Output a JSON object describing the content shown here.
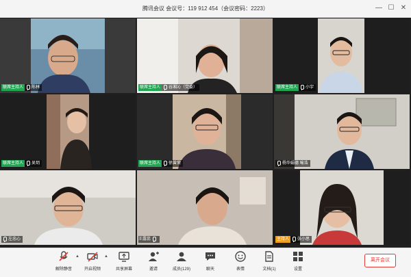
{
  "window": {
    "title": "腾讯会议 会议号：119 912 454（会议密码：2223）",
    "controls": [
      "—",
      "☐",
      "✕"
    ]
  },
  "participants": [
    {
      "role": "联席主持人",
      "name": "陈林",
      "role_color": "#21a653"
    },
    {
      "role": "联席主持人",
      "name": "谷湘沁（党委）",
      "role_color": "#21a653"
    },
    {
      "role": "联席主持人",
      "name": "小宇",
      "role_color": "#21a653"
    },
    {
      "role": "联席主持人",
      "name": "吴玥",
      "role_color": "#21a653"
    },
    {
      "role": "联席主持人",
      "name": "徐曾荣",
      "role_color": "#21a653"
    },
    {
      "role": "",
      "name": "杨华娟德 喻浩",
      "role_color": ""
    },
    {
      "role": "",
      "name": "左忠心",
      "role_color": ""
    },
    {
      "role": "",
      "name": "王露蕊",
      "role_color": ""
    },
    {
      "role": "主持人",
      "name": "张小思",
      "role_color": "#f0a020"
    }
  ],
  "toolbar": {
    "unmute": "解除静音",
    "video": "开启视频",
    "share": "共享屏幕",
    "invite": "邀请",
    "members": "成员(129)",
    "chat": "聊天",
    "reaction": "表情",
    "docs": "文档(1)",
    "settings": "设置",
    "leave": "离开会议"
  },
  "colors": {
    "accent_red": "#e53935",
    "host_green": "#21a653",
    "host_orange": "#f0a020"
  }
}
